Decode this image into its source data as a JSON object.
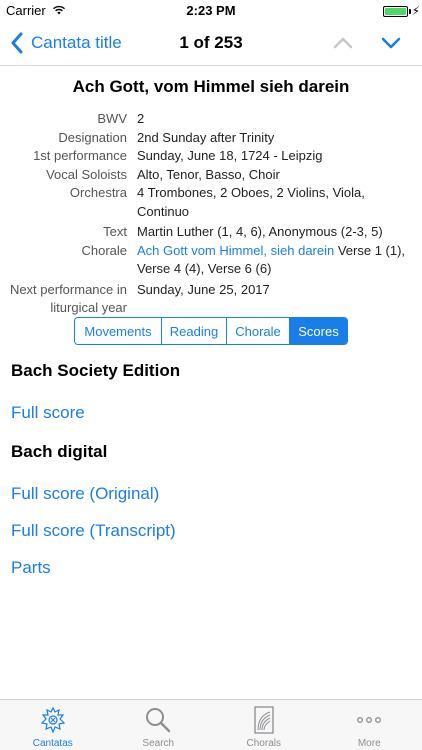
{
  "status": {
    "carrier": "Carrier",
    "time": "2:23 PM"
  },
  "nav": {
    "back_label": "Cantata title",
    "title": "1 of 253"
  },
  "cantata": {
    "title": "Ach Gott, vom Himmel sieh darein",
    "fields": {
      "bwv_label": "BWV",
      "bwv": "2",
      "designation_label": "Designation",
      "designation": "2nd Sunday after Trinity",
      "first_perf_label": "1st performance",
      "first_perf": "Sunday, June 18, 1724 - Leipzig",
      "soloists_label": "Vocal Soloists",
      "soloists": "Alto, Tenor, Basso, Choir",
      "orchestra_label": "Orchestra",
      "orchestra_line1": "4 Trombones, 2 Oboes, 2 Violins, Viola,",
      "orchestra_line2": "Continuo",
      "text_label": "Text",
      "text": "Martin Luther (1, 4, 6), Anonymous (2-3, 5)",
      "chorale_label": "Chorale",
      "chorale_link": "Ach Gott vom Himmel, sieh darein",
      "chorale_rest1": " Verse 1 (1),",
      "chorale_rest2": "Verse 4 (4), Verse 6 (6)",
      "next_label_line1": "Next performance in",
      "next_label_line2": "liturgical year",
      "next": "Sunday, June 25, 2017"
    }
  },
  "segments": [
    "Movements",
    "Reading",
    "Chorale",
    "Scores"
  ],
  "active_segment": "Scores",
  "scores": {
    "bach_society": {
      "heading": "Bach Society Edition",
      "links": [
        "Full score"
      ]
    },
    "bach_digital": {
      "heading": "Bach digital",
      "links": [
        "Full score (Original)",
        "Full score (Transcript)",
        "Parts"
      ]
    }
  },
  "tabs": [
    {
      "label": "Cantatas",
      "icon": "bach-crest-icon",
      "active": true
    },
    {
      "label": "Search",
      "icon": "magnifier-icon",
      "active": false
    },
    {
      "label": "Chorals",
      "icon": "score-sheet-icon",
      "active": false
    },
    {
      "label": "More",
      "icon": "ellipsis-icon",
      "active": false
    }
  ],
  "colors": {
    "accent": "#1a7ee8",
    "battery": "#4cd964"
  }
}
